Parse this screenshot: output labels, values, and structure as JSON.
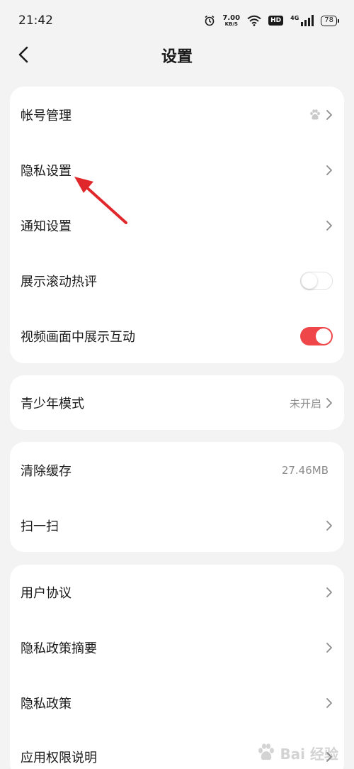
{
  "status_bar": {
    "time": "21:42",
    "speed_value": "7.00",
    "speed_unit": "KB/S",
    "hd": "HD",
    "network": "4G",
    "battery": "78"
  },
  "header": {
    "title": "设置"
  },
  "groups": [
    {
      "rows": [
        {
          "label": "帐号管理",
          "trailing": "paw-icon+chevron"
        },
        {
          "label": "隐私设置",
          "trailing": "chevron"
        },
        {
          "label": "通知设置",
          "trailing": "chevron"
        },
        {
          "label": "展示滚动热评",
          "trailing": "toggle",
          "enabled": false
        },
        {
          "label": "视频画面中展示互动",
          "trailing": "toggle",
          "enabled": true
        }
      ]
    },
    {
      "rows": [
        {
          "label": "青少年模式",
          "value": "未开启",
          "trailing": "chevron"
        }
      ]
    },
    {
      "rows": [
        {
          "label": "清除缓存",
          "value": "27.46MB"
        },
        {
          "label": "扫一扫",
          "trailing": "chevron"
        }
      ]
    },
    {
      "rows": [
        {
          "label": "用户协议",
          "trailing": "chevron"
        },
        {
          "label": "隐私政策摘要",
          "trailing": "chevron"
        },
        {
          "label": "隐私政策",
          "trailing": "chevron"
        },
        {
          "label": "应用权限说明",
          "trailing": "chevron"
        }
      ]
    }
  ],
  "colors": {
    "background": "#f3f3f3",
    "card": "#ffffff",
    "toggle_on": "#ef4749",
    "annotation_arrow": "#e0282c",
    "secondary_text": "#8c8c8c"
  },
  "watermark": {
    "text": "Bai 经验",
    "icon": "baidu-paw-logo"
  }
}
